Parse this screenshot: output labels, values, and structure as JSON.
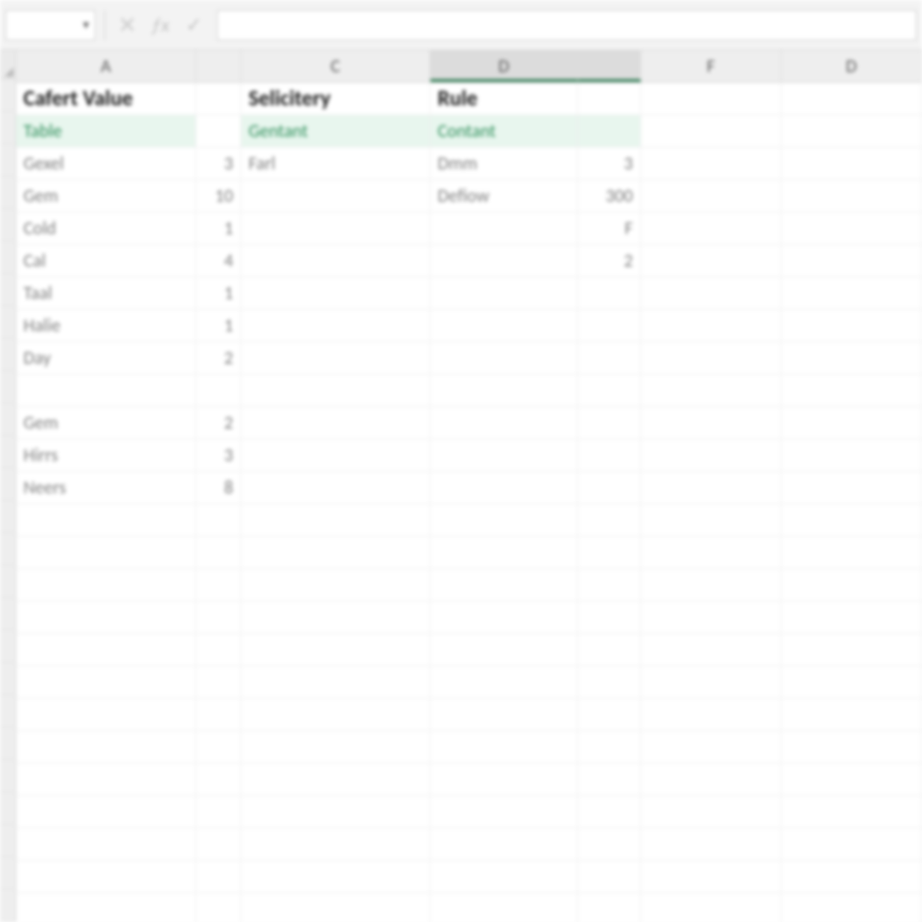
{
  "formula_bar": {
    "namebox_value": "",
    "fx_label": "ƒx",
    "cancel_glyph": "✕",
    "accept_glyph": "✓",
    "formula_value": ""
  },
  "columns": [
    {
      "key": "A",
      "label": "A",
      "w": "cA",
      "selected": false
    },
    {
      "key": "B",
      "label": "",
      "w": "cB",
      "selected": false
    },
    {
      "key": "C",
      "label": "C",
      "w": "cC",
      "selected": false
    },
    {
      "key": "D",
      "label": "D",
      "w": "cD",
      "selected": true
    },
    {
      "key": "E",
      "label": "",
      "w": "cE",
      "selected": true
    },
    {
      "key": "F",
      "label": "F",
      "w": "cF",
      "selected": false
    },
    {
      "key": "G",
      "label": "D",
      "w": "cG",
      "selected": false
    }
  ],
  "row_count": 26,
  "cells": {
    "r1": {
      "A": {
        "t": "Cafert Value",
        "cls": "headerbold"
      },
      "C": {
        "t": "Selicitery",
        "cls": "headerbold"
      },
      "D": {
        "t": "Rule",
        "cls": "headerbold"
      }
    },
    "r2": {
      "A": {
        "t": "Table",
        "cls": "greentext"
      },
      "C": {
        "t": "Gentant",
        "cls": "greentext"
      },
      "D": {
        "t": "Contant",
        "cls": "greentext"
      },
      "E": {
        "t": "",
        "cls": "greentext"
      }
    },
    "r3": {
      "A": {
        "t": "Gexel",
        "cls": "faded"
      },
      "B": {
        "t": "3",
        "cls": "num faded"
      },
      "C": {
        "t": "Farl",
        "cls": "faded"
      },
      "D": {
        "t": "Dmm",
        "cls": "faded"
      },
      "E": {
        "t": "3",
        "cls": "num faded"
      }
    },
    "r4": {
      "A": {
        "t": "Gem",
        "cls": "faded"
      },
      "B": {
        "t": "10",
        "cls": "num faded"
      },
      "D": {
        "t": "Defiow",
        "cls": "faded"
      },
      "E": {
        "t": "300",
        "cls": "num faded"
      }
    },
    "r5": {
      "A": {
        "t": "Cold",
        "cls": "faded"
      },
      "B": {
        "t": "1",
        "cls": "num faded"
      },
      "E": {
        "t": "F",
        "cls": "num faded"
      }
    },
    "r6": {
      "A": {
        "t": "Cal",
        "cls": "faded"
      },
      "B": {
        "t": "4",
        "cls": "num faded"
      },
      "E": {
        "t": "2",
        "cls": "num faded"
      }
    },
    "r7": {
      "A": {
        "t": "Taal",
        "cls": "faded"
      },
      "B": {
        "t": "1",
        "cls": "num faded"
      }
    },
    "r8": {
      "A": {
        "t": "Halie",
        "cls": "faded"
      },
      "B": {
        "t": "1",
        "cls": "num faded"
      }
    },
    "r9": {
      "A": {
        "t": "Day",
        "cls": "faded"
      },
      "B": {
        "t": "2",
        "cls": "num faded"
      }
    },
    "r10": {},
    "r11": {
      "A": {
        "t": "Gem",
        "cls": "faded"
      },
      "B": {
        "t": "2",
        "cls": "num faded"
      }
    },
    "r12": {
      "A": {
        "t": "Hirrs",
        "cls": "faded"
      },
      "B": {
        "t": "3",
        "cls": "num faded"
      }
    },
    "r13": {
      "A": {
        "t": "Neers",
        "cls": "faded"
      },
      "B": {
        "t": "8",
        "cls": "num faded"
      }
    }
  }
}
